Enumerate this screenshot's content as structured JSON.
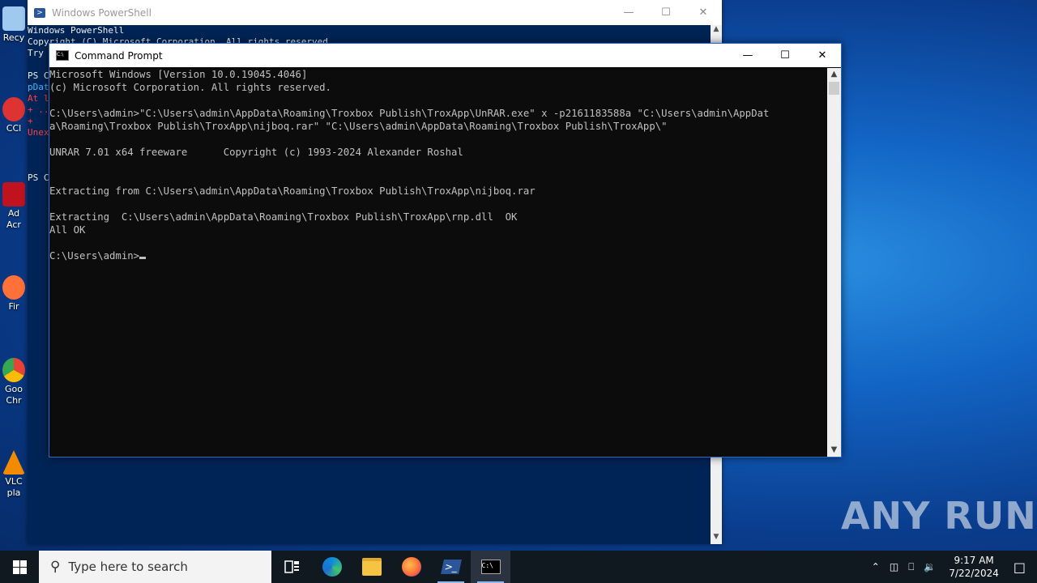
{
  "desktop": {
    "icons": [
      {
        "label": "Recy",
        "color": "#9fc9ef"
      },
      {
        "label": "CCl",
        "color": "#d33"
      },
      {
        "label": "Ad\nAcr",
        "color": "#c1121f"
      },
      {
        "label": "Fir",
        "color": "#ff7139"
      },
      {
        "label": "Goo\nChr",
        "color": "#34a853"
      },
      {
        "label": "VLC\npla",
        "color": "#f28b00"
      }
    ]
  },
  "powershell": {
    "title": "Windows PowerShell",
    "lines": [
      "Windows PowerShell",
      "Copyright (C) Microsoft Corporation. All rights reserved.",
      "",
      "Try",
      "",
      "PS C",
      "pDat",
      "At l",
      "+ ..",
      "+",
      "Unex",
      "",
      "",
      "",
      "PS C"
    ]
  },
  "cmd": {
    "title": "Command Prompt",
    "lines": [
      "Microsoft Windows [Version 10.0.19045.4046]",
      "(c) Microsoft Corporation. All rights reserved.",
      "",
      "C:\\Users\\admin>\"C:\\Users\\admin\\AppData\\Roaming\\Troxbox Publish\\TroxApp\\UnRAR.exe\" x -p2161183588a \"C:\\Users\\admin\\AppDat",
      "a\\Roaming\\Troxbox Publish\\TroxApp\\nijboq.rar\" \"C:\\Users\\admin\\AppData\\Roaming\\Troxbox Publish\\TroxApp\\\"",
      "",
      "UNRAR 7.01 x64 freeware      Copyright (c) 1993-2024 Alexander Roshal",
      "",
      "",
      "Extracting from C:\\Users\\admin\\AppData\\Roaming\\Troxbox Publish\\TroxApp\\nijboq.rar",
      "",
      "Extracting  C:\\Users\\admin\\AppData\\Roaming\\Troxbox Publish\\TroxApp\\rnp.dll  OK",
      "All OK",
      ""
    ],
    "prompt": "C:\\Users\\admin>"
  },
  "watermark": "ANY RUN",
  "taskbar": {
    "search_placeholder": "Type here to search",
    "time": "9:17 AM",
    "date": "7/22/2024",
    "apps": [
      "task-view",
      "edge",
      "file-explorer",
      "firefox",
      "powershell",
      "command-prompt"
    ]
  }
}
